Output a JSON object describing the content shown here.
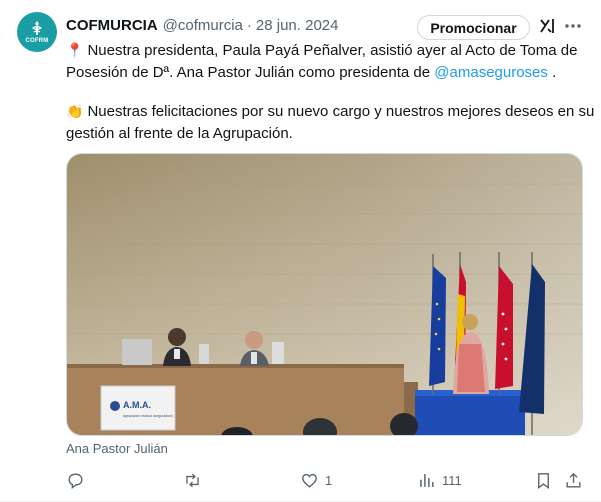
{
  "tweet": {
    "display_name": "COFMURCIA",
    "handle": "@cofmurcia",
    "separator": "·",
    "date": "28 jun. 2024",
    "avatar_text": "COFRM",
    "promote_label": "Promocionar",
    "paragraph1_emoji": "📍",
    "paragraph1_text": "Nuestra presidenta, Paula Payá Peñalver, asistió ayer al Acto de Toma de Posesión de Dª. Ana Pastor Julián como presidenta de ",
    "paragraph1_mention": "@amaseguroses",
    "paragraph1_end": " .",
    "paragraph2_emoji": "👏",
    "paragraph2_text": "Nuestras felicitaciones por su nuevo cargo y nuestros mejores deseos en su gestión al frente de la Agrupación.",
    "media_caption": "Ana Pastor Julián",
    "media_sign_title": "A.M.A.",
    "media_sign_subtitle": "agrupación mutual aseguradora"
  },
  "actions": {
    "reply_count": "",
    "retweet_count": "",
    "like_count": "1",
    "views_count": "111"
  },
  "colors": {
    "accent": "#1d9bf0",
    "muted": "#536471",
    "avatar_bg": "#1a9ea3"
  },
  "icons": [
    "grok-icon",
    "more-icon",
    "reply-icon",
    "retweet-icon",
    "like-icon",
    "views-icon",
    "bookmark-icon",
    "share-icon"
  ]
}
